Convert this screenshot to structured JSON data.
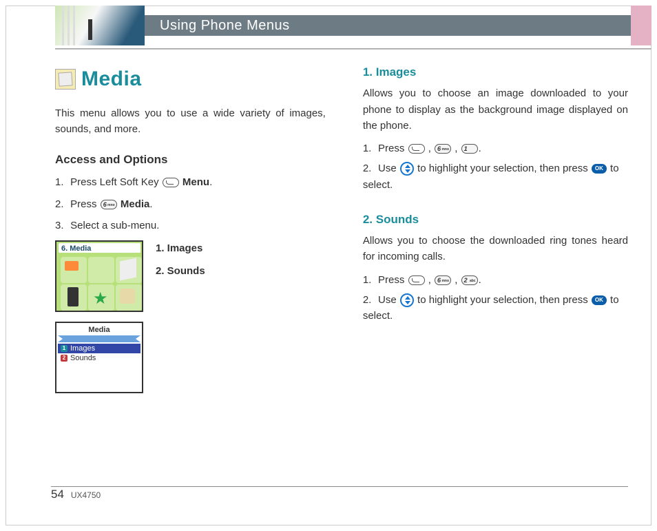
{
  "header": {
    "title": "Using Phone Menus"
  },
  "media": {
    "heading": "Media",
    "intro": "This menu allows you to use a wide variety of images, sounds, and more."
  },
  "access": {
    "heading": "Access and Options",
    "steps": {
      "s1_pre": "Press Left Soft Key",
      "s1_post": "Menu",
      "s2_pre": "Press",
      "s2_post": "Media",
      "s3": "Select a sub-menu."
    }
  },
  "shots": {
    "shot1_title": "6. Media",
    "shot2_title": "Media",
    "shot2_r1": "Images",
    "shot2_r2": "Sounds"
  },
  "sublist": {
    "i1": "1. Images",
    "i2": "2. Sounds"
  },
  "images": {
    "heading": "1. Images",
    "desc": "Allows you to choose an image downloaded to your phone to display as the background image displayed on the phone.",
    "s1_pre": "Press",
    "s2_pre": "Use",
    "s2_mid": "to highlight your selection, then press",
    "s2_post": "to select."
  },
  "sounds": {
    "heading": "2. Sounds",
    "desc": "Allows you to choose the downloaded ring tones heard for incoming calls.",
    "s1_pre": "Press",
    "s2_pre": "Use",
    "s2_mid": "to highlight your selection, then press",
    "s2_post": "to select."
  },
  "footer": {
    "page": "54",
    "model": "UX4750"
  },
  "labels": {
    "period": ".",
    "comma_sp": " ,  "
  }
}
